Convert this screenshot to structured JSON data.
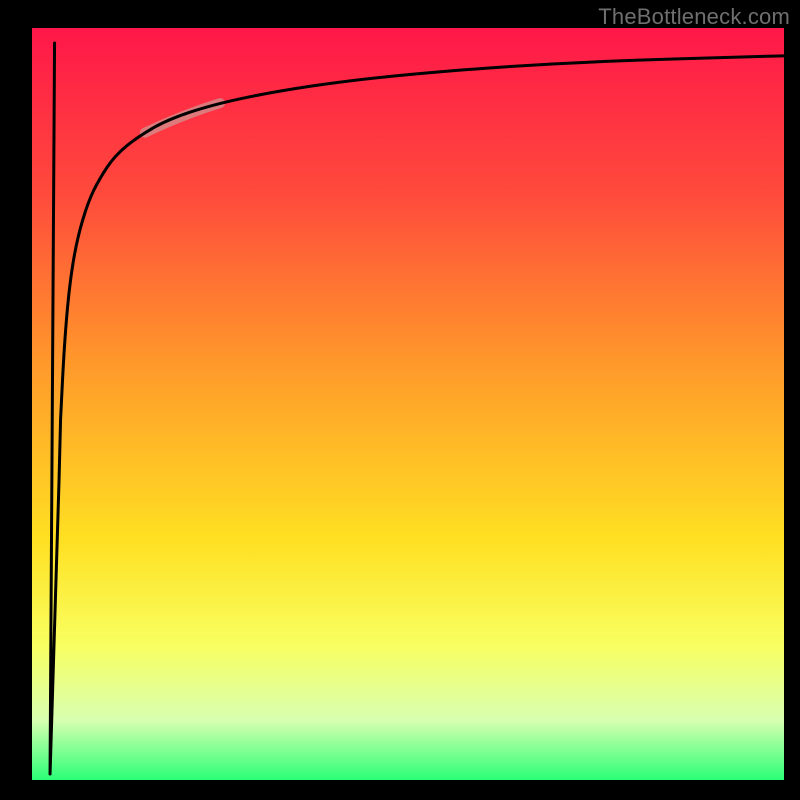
{
  "watermark": "TheBottleneck.com",
  "chart_data": {
    "type": "line",
    "title": "",
    "xlabel": "",
    "ylabel": "",
    "xlim": [
      0,
      100
    ],
    "ylim": [
      0,
      100
    ],
    "grid": false,
    "background_gradient": {
      "stops": [
        {
          "pos": 0.0,
          "color": "#ff1749"
        },
        {
          "pos": 0.22,
          "color": "#ff4a3c"
        },
        {
          "pos": 0.45,
          "color": "#ff9a2a"
        },
        {
          "pos": 0.68,
          "color": "#ffe022"
        },
        {
          "pos": 0.82,
          "color": "#f8ff60"
        },
        {
          "pos": 0.92,
          "color": "#d8ffb0"
        },
        {
          "pos": 1.0,
          "color": "#2bff77"
        }
      ]
    },
    "highlight_segment": {
      "x0": 15,
      "x1": 25,
      "color": "#cf9593",
      "opacity": 0.72,
      "width": 10
    },
    "series": [
      {
        "name": "curve",
        "color": "#000000",
        "width": 3,
        "x": [
          2.2,
          2.6,
          3.0,
          3.5,
          3.5,
          3.8,
          4.3,
          5.0,
          6.0,
          7.5,
          9,
          11,
          14,
          18,
          24,
          32,
          42,
          54,
          68,
          82,
          100
        ],
        "y": [
          0.5,
          5,
          98,
          60,
          35,
          48,
          58,
          66,
          72,
          77,
          80,
          83,
          85.5,
          87.8,
          89.8,
          91.5,
          93,
          94.2,
          95.2,
          95.8,
          96.3
        ]
      }
    ]
  }
}
